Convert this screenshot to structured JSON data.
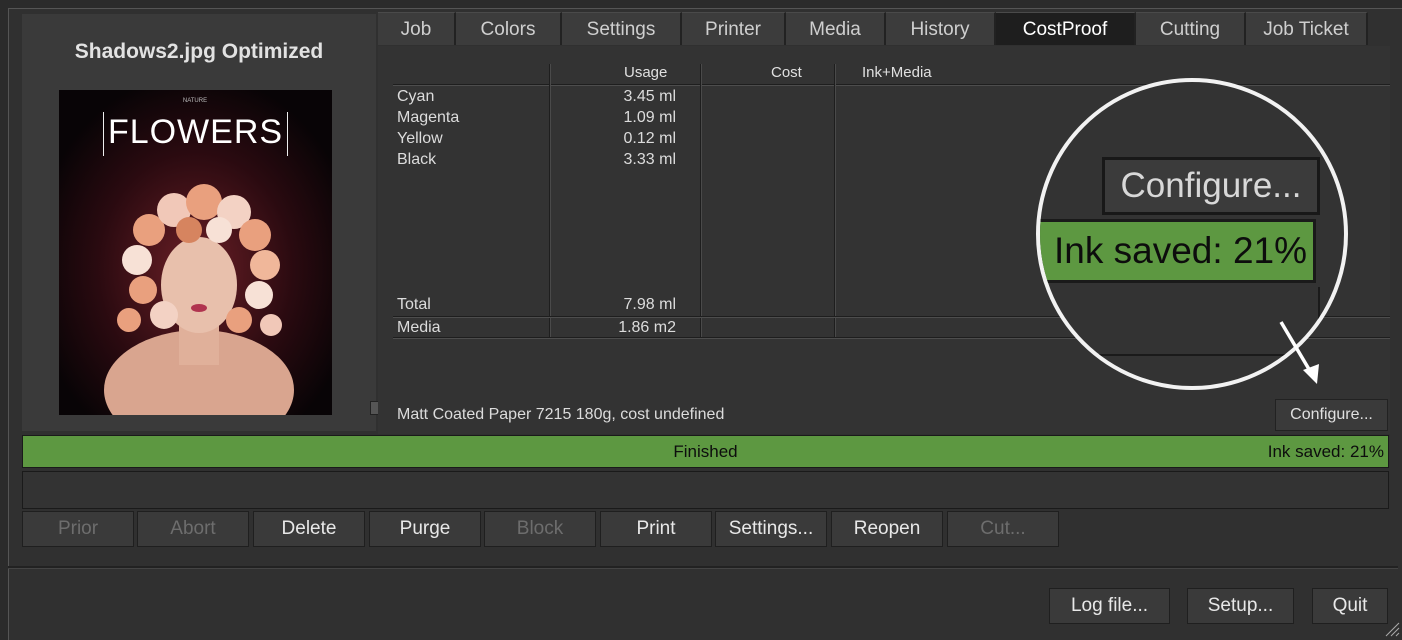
{
  "preview": {
    "title": "Shadows2.jpg Optimized",
    "thumb_small": "NATURE",
    "thumb_word": "FLOWERS"
  },
  "tabs": [
    {
      "label": "Job"
    },
    {
      "label": "Colors"
    },
    {
      "label": "Settings"
    },
    {
      "label": "Printer"
    },
    {
      "label": "Media"
    },
    {
      "label": "History"
    },
    {
      "label": "CostProof",
      "active": true
    },
    {
      "label": "Cutting"
    },
    {
      "label": "Job Ticket"
    }
  ],
  "table": {
    "headers": {
      "usage": "Usage",
      "cost": "Cost",
      "ink_media": "Ink+Media"
    },
    "rows": [
      {
        "name": "Cyan",
        "usage": "3.45 ml"
      },
      {
        "name": "Magenta",
        "usage": "1.09 ml"
      },
      {
        "name": "Yellow",
        "usage": "0.12 ml"
      },
      {
        "name": "Black",
        "usage": "3.33 ml"
      }
    ],
    "total": {
      "name": "Total",
      "usage": "7.98 ml"
    },
    "media": {
      "name": "Media",
      "usage": "1.86 m2"
    }
  },
  "paper_text": "Matt Coated Paper 7215 180g, cost undefined",
  "configure_label": "Configure...",
  "magnifier": {
    "configure_label": "Configure...",
    "ink_saved": "Ink saved: 21%"
  },
  "status": {
    "text": "Finished",
    "ink_saved": "Ink saved: 21%",
    "color": "#5d9841"
  },
  "actions": [
    {
      "label": "Prior",
      "enabled": false
    },
    {
      "label": "Abort",
      "enabled": false
    },
    {
      "label": "Delete",
      "enabled": true
    },
    {
      "label": "Purge",
      "enabled": true
    },
    {
      "label": "Block",
      "enabled": false
    },
    {
      "label": "Print",
      "enabled": true
    },
    {
      "label": "Settings...",
      "enabled": true
    },
    {
      "label": "Reopen",
      "enabled": true
    },
    {
      "label": "Cut...",
      "enabled": false
    }
  ],
  "footer": {
    "log_label": "Log file...",
    "setup_label": "Setup...",
    "quit_label": "Quit"
  }
}
